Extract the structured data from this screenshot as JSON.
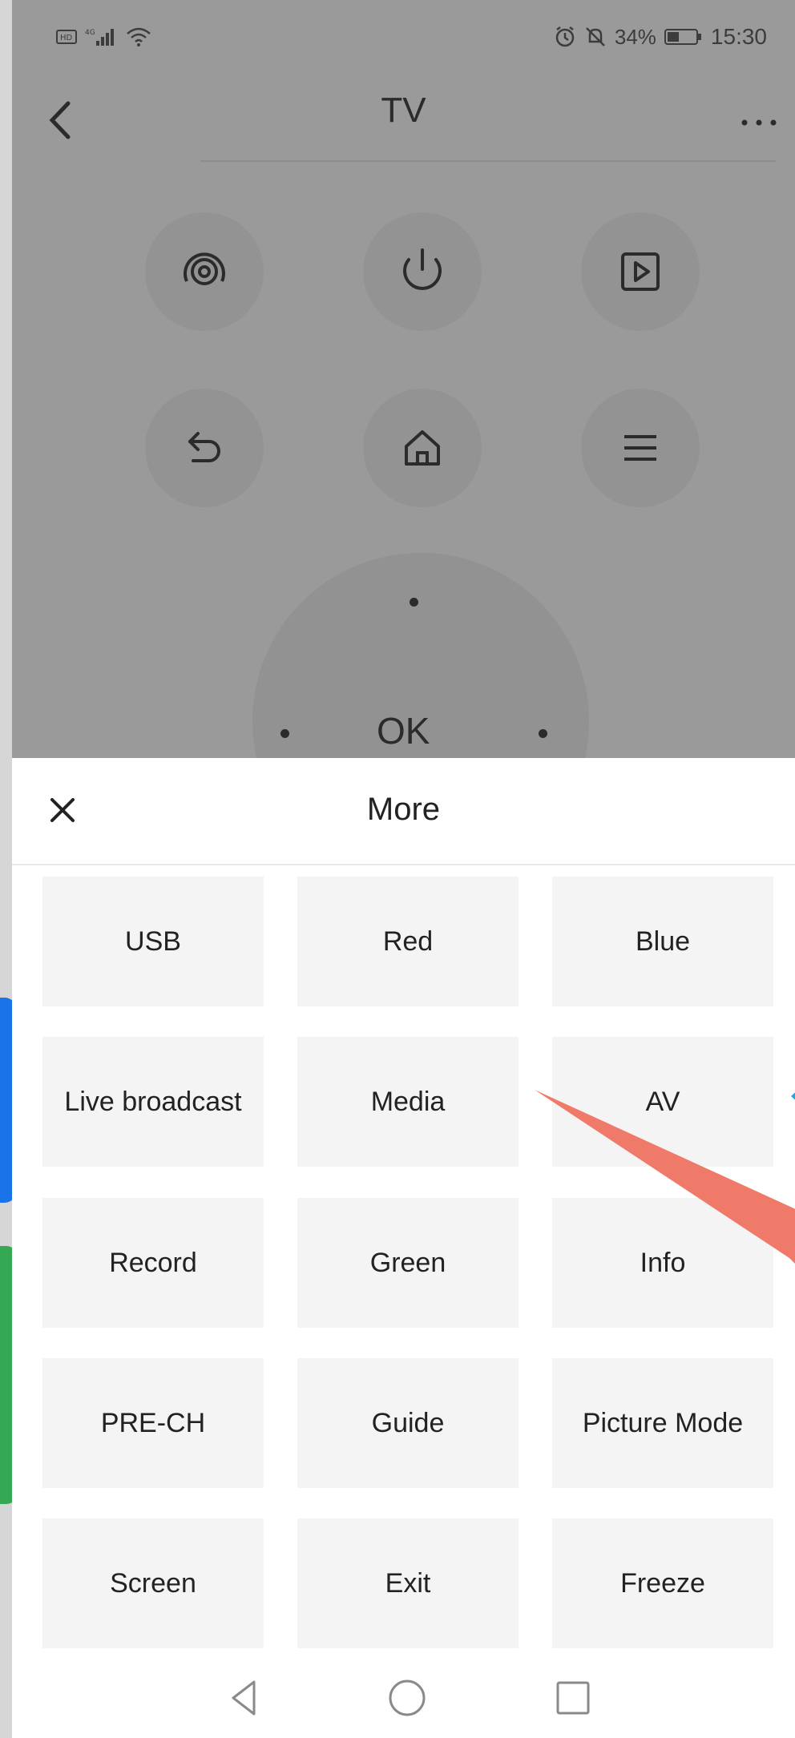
{
  "status": {
    "battery": "34%",
    "time": "15:30"
  },
  "header": {
    "title": "TV"
  },
  "remote": {
    "ok_label": "OK"
  },
  "sheet": {
    "title": "More",
    "buttons": [
      "USB",
      "Red",
      "Blue",
      "Live broadcast",
      "Media",
      "AV",
      "Record",
      "Green",
      "Info",
      "PRE-CH",
      "Guide",
      "Picture Mode",
      "Screen",
      "Exit",
      "Freeze"
    ]
  },
  "colors": {
    "callout_blue": "#1a73e8",
    "callout_green": "#34a853",
    "arrow_red": "#f07a6a",
    "marker_cyan": "#1aa9e8"
  }
}
